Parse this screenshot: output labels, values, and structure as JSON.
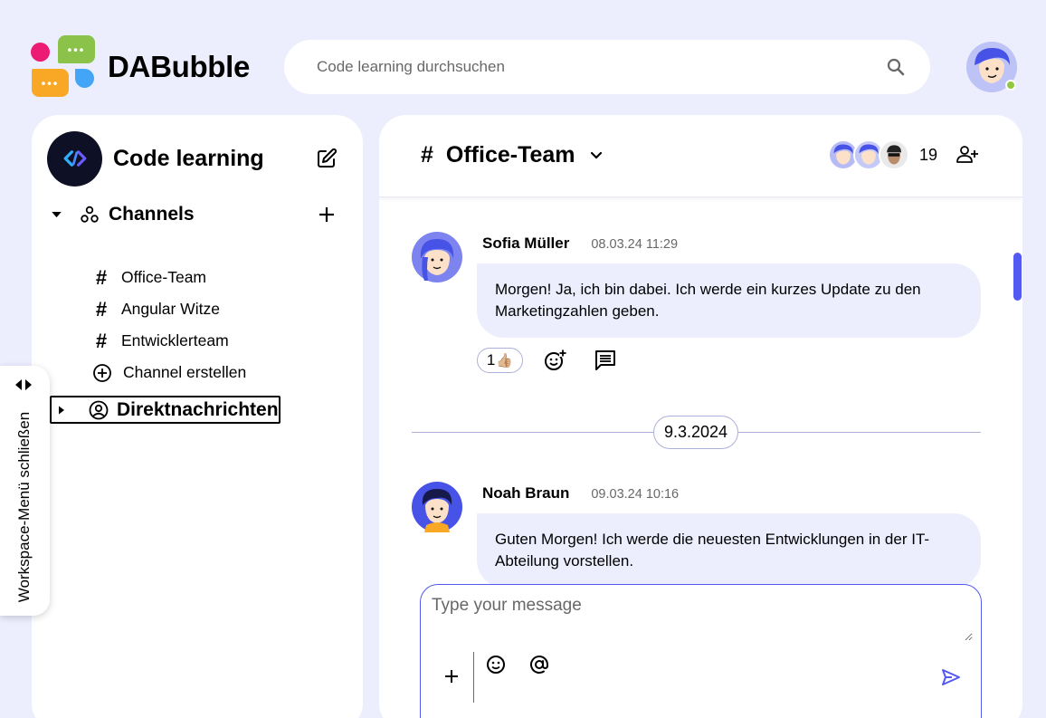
{
  "app": {
    "name": "DABubble",
    "logo_dots": "•••"
  },
  "search": {
    "placeholder": "Code learning durchsuchen"
  },
  "sidebar": {
    "workspace_name": "Code learning",
    "channels_label": "Channels",
    "channels": [
      {
        "name": "Office-Team"
      },
      {
        "name": "Angular Witze"
      },
      {
        "name": "Entwicklerteam"
      }
    ],
    "create_channel_label": "Channel erstellen",
    "direct_messages_label": "Direktnachrichten",
    "toggle_label": "Workspace-Menü schließen"
  },
  "channel": {
    "hash": "#",
    "name": "Office-Team",
    "member_count": "19"
  },
  "messages": [
    {
      "author": "Sofia Müller",
      "time": "08.03.24 11:29",
      "text": "Morgen! Ja, ich bin dabei. Ich werde ein kurzes Update zu den Marketingzahlen geben.",
      "reaction_count": "1",
      "reaction_emoji": "👍🏼"
    },
    {
      "author": "Noah Braun",
      "time": "09.03.24 10:16",
      "text": "Guten Morgen! Ich werde die neuesten Entwicklungen in der IT-Abteilung vorstellen."
    }
  ],
  "date_separator": "9.3.2024",
  "composer": {
    "placeholder": "Type your message"
  },
  "colors": {
    "background": "#eceefe",
    "accent": "#535af1",
    "online": "#92c83e",
    "bubble": "#eceefe"
  },
  "icons": {
    "search": "search-icon",
    "edit": "edit-square-icon",
    "add_member": "person-add-icon",
    "send": "send-icon"
  }
}
